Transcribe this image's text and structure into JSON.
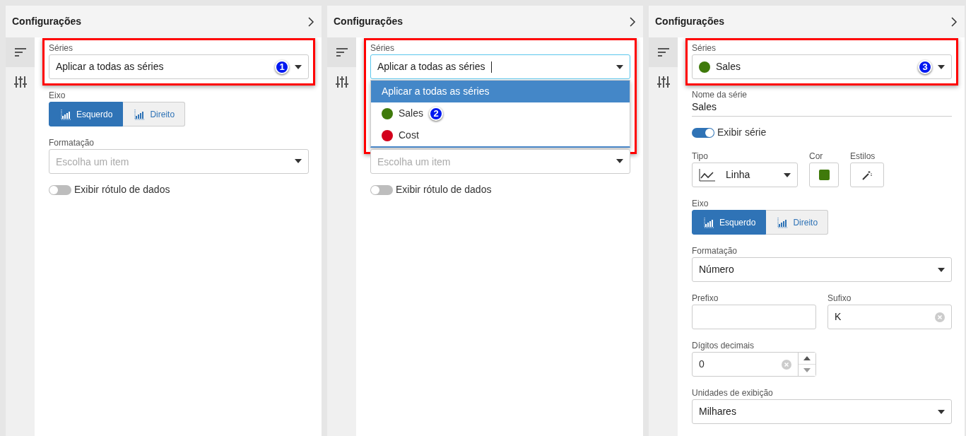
{
  "panels": [
    {
      "title": "Configurações",
      "nav": [
        {
          "selected": true
        },
        {
          "selected": false
        }
      ],
      "fields": [
        {
          "kind": "select",
          "label": "Séries",
          "value": "Aplicar a todas as séries",
          "highlighted": true,
          "callout": "1"
        },
        {
          "kind": "segmented",
          "label": "Eixo",
          "options": [
            {
              "text": "Esquerdo",
              "selected": true
            },
            {
              "text": "Direito",
              "selected": false
            }
          ]
        },
        {
          "kind": "select",
          "label": "Formatação",
          "placeholder": "Escolha um item"
        },
        {
          "kind": "switch",
          "label": "Exibir rótulo de dados",
          "on": false
        }
      ]
    },
    {
      "title": "Configurações",
      "nav": [
        {
          "selected": true
        },
        {
          "selected": false
        }
      ],
      "fields": [
        {
          "kind": "select",
          "label": "Séries",
          "value": "Aplicar a todas as séries",
          "highlighted": true,
          "focused": true,
          "options": [
            {
              "text": "Aplicar a todas as séries",
              "selected": true
            },
            {
              "text": "Sales",
              "color": "#3f7a0b",
              "selected": false,
              "callout": "2"
            },
            {
              "text": "Cost",
              "color": "#d3001c",
              "selected": false
            }
          ]
        },
        {
          "kind": "select",
          "placeholder": "Escolha um item"
        },
        {
          "kind": "switch",
          "label": "Exibir rótulo de dados",
          "on": false
        }
      ]
    },
    {
      "title": "Configurações",
      "nav": [
        {
          "selected": true
        },
        {
          "selected": false
        }
      ],
      "fields": [
        {
          "kind": "select",
          "label": "Séries",
          "value": "Sales",
          "color": "#3f7a0b",
          "highlighted": true,
          "callout": "3"
        },
        {
          "kind": "underline",
          "label": "Nome da série",
          "value": "Sales"
        },
        {
          "kind": "switch",
          "label": "Exibir série",
          "on": true
        },
        {
          "kind": "typerow",
          "type_label": "Tipo",
          "type_value": "Linha",
          "color_label": "Cor",
          "color": "#3f7a0b",
          "styles_label": "Estilos"
        },
        {
          "kind": "segmented",
          "label": "Eixo",
          "options": [
            {
              "text": "Esquerdo",
              "selected": true
            },
            {
              "text": "Direito",
              "selected": false
            }
          ]
        },
        {
          "kind": "select",
          "label": "Formatação",
          "value": "Número"
        },
        {
          "kind": "pair",
          "items": [
            {
              "label": "Prefixo"
            },
            {
              "label": "Sufixo",
              "value": "K"
            }
          ]
        },
        {
          "kind": "number",
          "label": "Dígitos decimais",
          "value": "0"
        },
        {
          "kind": "select",
          "label": "Unidades de exibição",
          "value": "Milhares"
        }
      ]
    }
  ]
}
